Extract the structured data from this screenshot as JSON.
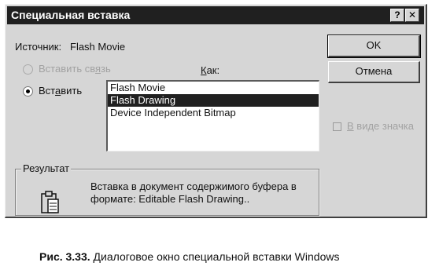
{
  "dialog": {
    "title": "Специальная вставка",
    "help_label": "?",
    "close_label": "✕",
    "source_label": "Источник:",
    "source_value": "Flash Movie",
    "as_label": "Как:",
    "paste_link_label": "Вставить связь",
    "paste_label": "Вставить",
    "selected_option": "paste",
    "list_items": [
      "Flash Movie",
      "Flash Drawing",
      "Device Independent Bitmap"
    ],
    "selected_item": "Flash Drawing",
    "ok_label": "OK",
    "cancel_label": "Отмена",
    "as_icon_label": "В виде значка",
    "as_icon_checked": false,
    "result_label": "Результат",
    "result_line1": "Вставка в документ содержимого буфера в",
    "result_line2": "формате: Editable Flash Drawing..",
    "result_icon": "clipboard-icon"
  },
  "caption": {
    "prefix": "Рис. 3.33.",
    "text": " Диалоговое окно специальной вставки Windows"
  }
}
